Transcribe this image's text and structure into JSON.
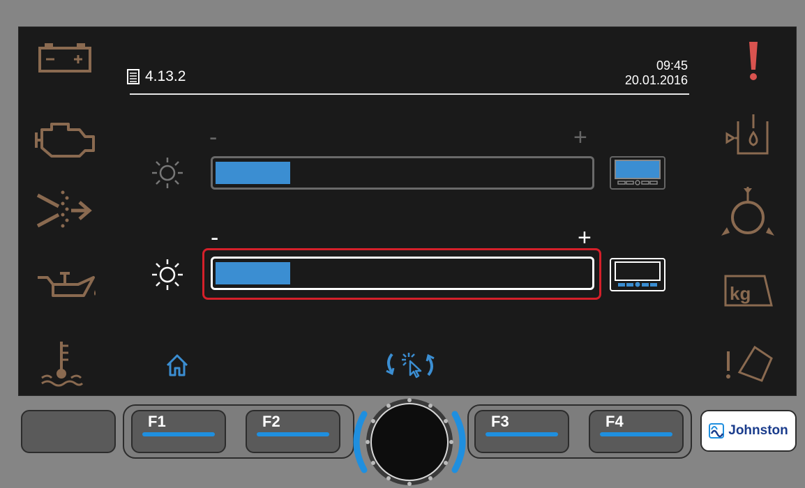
{
  "header": {
    "menu_code": "4.13.2",
    "time": "09:45",
    "date": "20.01.2016"
  },
  "brightness_rows": [
    {
      "minus": "-",
      "plus": "+",
      "level": 0.2,
      "state": "inactive"
    },
    {
      "minus": "-",
      "plus": "+",
      "level": 0.2,
      "state": "selected"
    }
  ],
  "left_icons": [
    "battery-icon",
    "engine-icon",
    "spray-nozzle-icon",
    "oil-can-icon",
    "coolant-temperature-icon"
  ],
  "right_icons": [
    "warning-exclamation-icon",
    "water-tank-icon",
    "fan-pump-icon",
    "weight-kg-icon",
    "tipping-hopper-icon"
  ],
  "right_icon_text": {
    "weight": "kg"
  },
  "bottom_icons": [
    "home-icon",
    "rotary-select-icon"
  ],
  "function_keys": [
    {
      "label": "F1"
    },
    {
      "label": "F2"
    },
    {
      "label": "F3"
    },
    {
      "label": "F4"
    }
  ],
  "brand": {
    "name": "Johnston"
  },
  "colors": {
    "accent_blue": "#3b8ed2",
    "selection_red": "#d5202a",
    "icon_brown": "#8a6a50",
    "screen_bg": "#1a1a1a"
  }
}
